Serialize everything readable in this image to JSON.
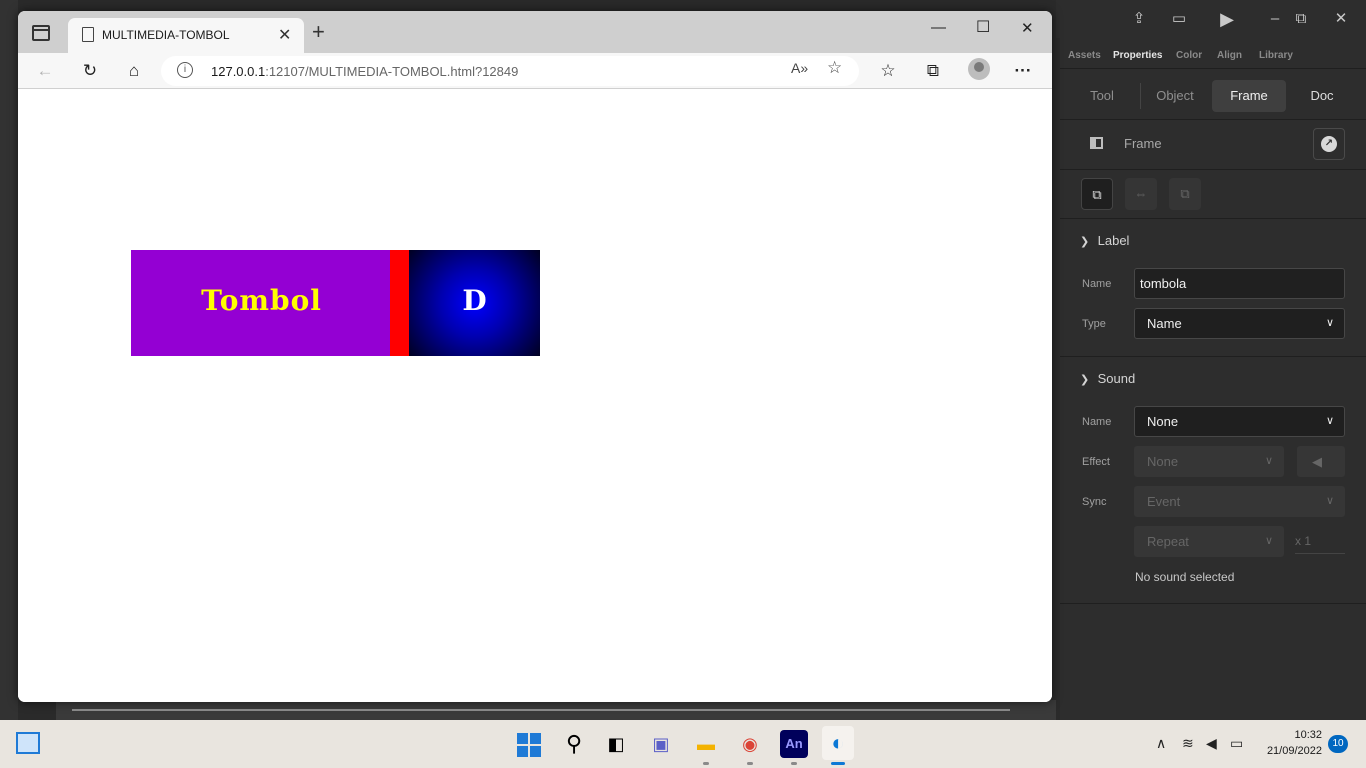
{
  "browser": {
    "tab_title": "MULTIMEDIA-TOMBOL",
    "url_host": "127.0.0.1",
    "url_rest": ":12107/MULTIMEDIA-TOMBOL.html?12849"
  },
  "banner": {
    "label": "Tombol",
    "letter": "D",
    "colors": {
      "purple": "#9400d3",
      "yellow_text": "#ffff00",
      "red_bar": "#ff0000",
      "blue": "#0000ff"
    }
  },
  "panel": {
    "tabs": [
      "Assets",
      "Properties",
      "Color",
      "Align",
      "Library"
    ],
    "active_tab": "Properties",
    "modes": [
      "Tool",
      "Object",
      "Frame",
      "Doc"
    ],
    "active_mode": "Frame",
    "frame_label": "Frame",
    "label_section": {
      "title": "Label",
      "name_label": "Name",
      "name_value": "tombola",
      "type_label": "Type",
      "type_value": "Name"
    },
    "sound_section": {
      "title": "Sound",
      "name_label": "Name",
      "name_value": "None",
      "effect_label": "Effect",
      "effect_value": "None",
      "sync_label": "Sync",
      "sync_value": "Event",
      "repeat_value": "Repeat",
      "repeat_count": "x 1",
      "status": "No sound selected"
    }
  },
  "taskbar": {
    "time": "10:32",
    "date": "21/09/2022",
    "notifications": "10",
    "apps": [
      "start",
      "search",
      "task-view",
      "chat",
      "file-explorer",
      "chrome",
      "animate",
      "edge"
    ],
    "animate_label": "An"
  }
}
